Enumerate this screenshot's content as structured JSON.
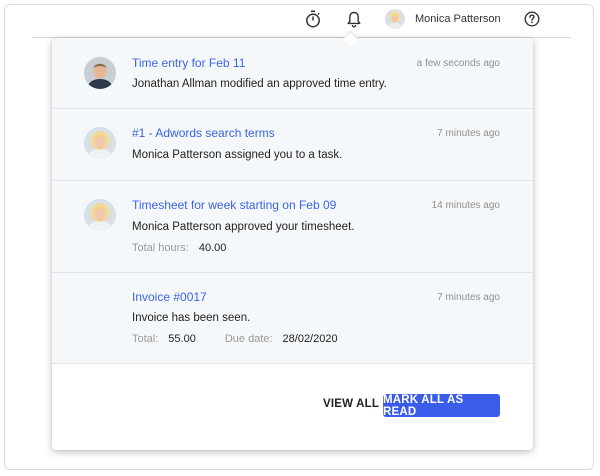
{
  "header": {
    "user_name": "Monica Patterson",
    "icons": [
      "stopwatch-icon",
      "bell-icon",
      "help-icon"
    ]
  },
  "notifications": [
    {
      "title": "Time entry for Feb 11",
      "time": "a few seconds ago",
      "message": "Jonathan Allman modified an approved time entry.",
      "avatar": "man-avatar"
    },
    {
      "title": "#1 - Adwords search terms",
      "time": "7 minutes ago",
      "message": "Monica Patterson assigned you to a task.",
      "avatar": "woman-avatar"
    },
    {
      "title": "Timesheet for week starting on Feb 09",
      "time": "14 minutes ago",
      "message": "Monica Patterson approved your timesheet.",
      "avatar": "woman-avatar",
      "meta": [
        {
          "label": "Total hours:",
          "value": "40.00"
        }
      ]
    },
    {
      "title": "Invoice #0017",
      "time": "7 minutes ago",
      "message": "Invoice has been seen.",
      "meta": [
        {
          "label": "Total:",
          "value": "55.00"
        },
        {
          "label": "Due date:",
          "value": "28/02/2020"
        }
      ]
    }
  ],
  "footer": {
    "view_all": "VIEW ALL",
    "mark_all": "MARK ALL AS READ"
  },
  "colors": {
    "link": "#3b63e6",
    "primary_button": "#3b5ce8",
    "item_background": "#f5f8fb"
  }
}
